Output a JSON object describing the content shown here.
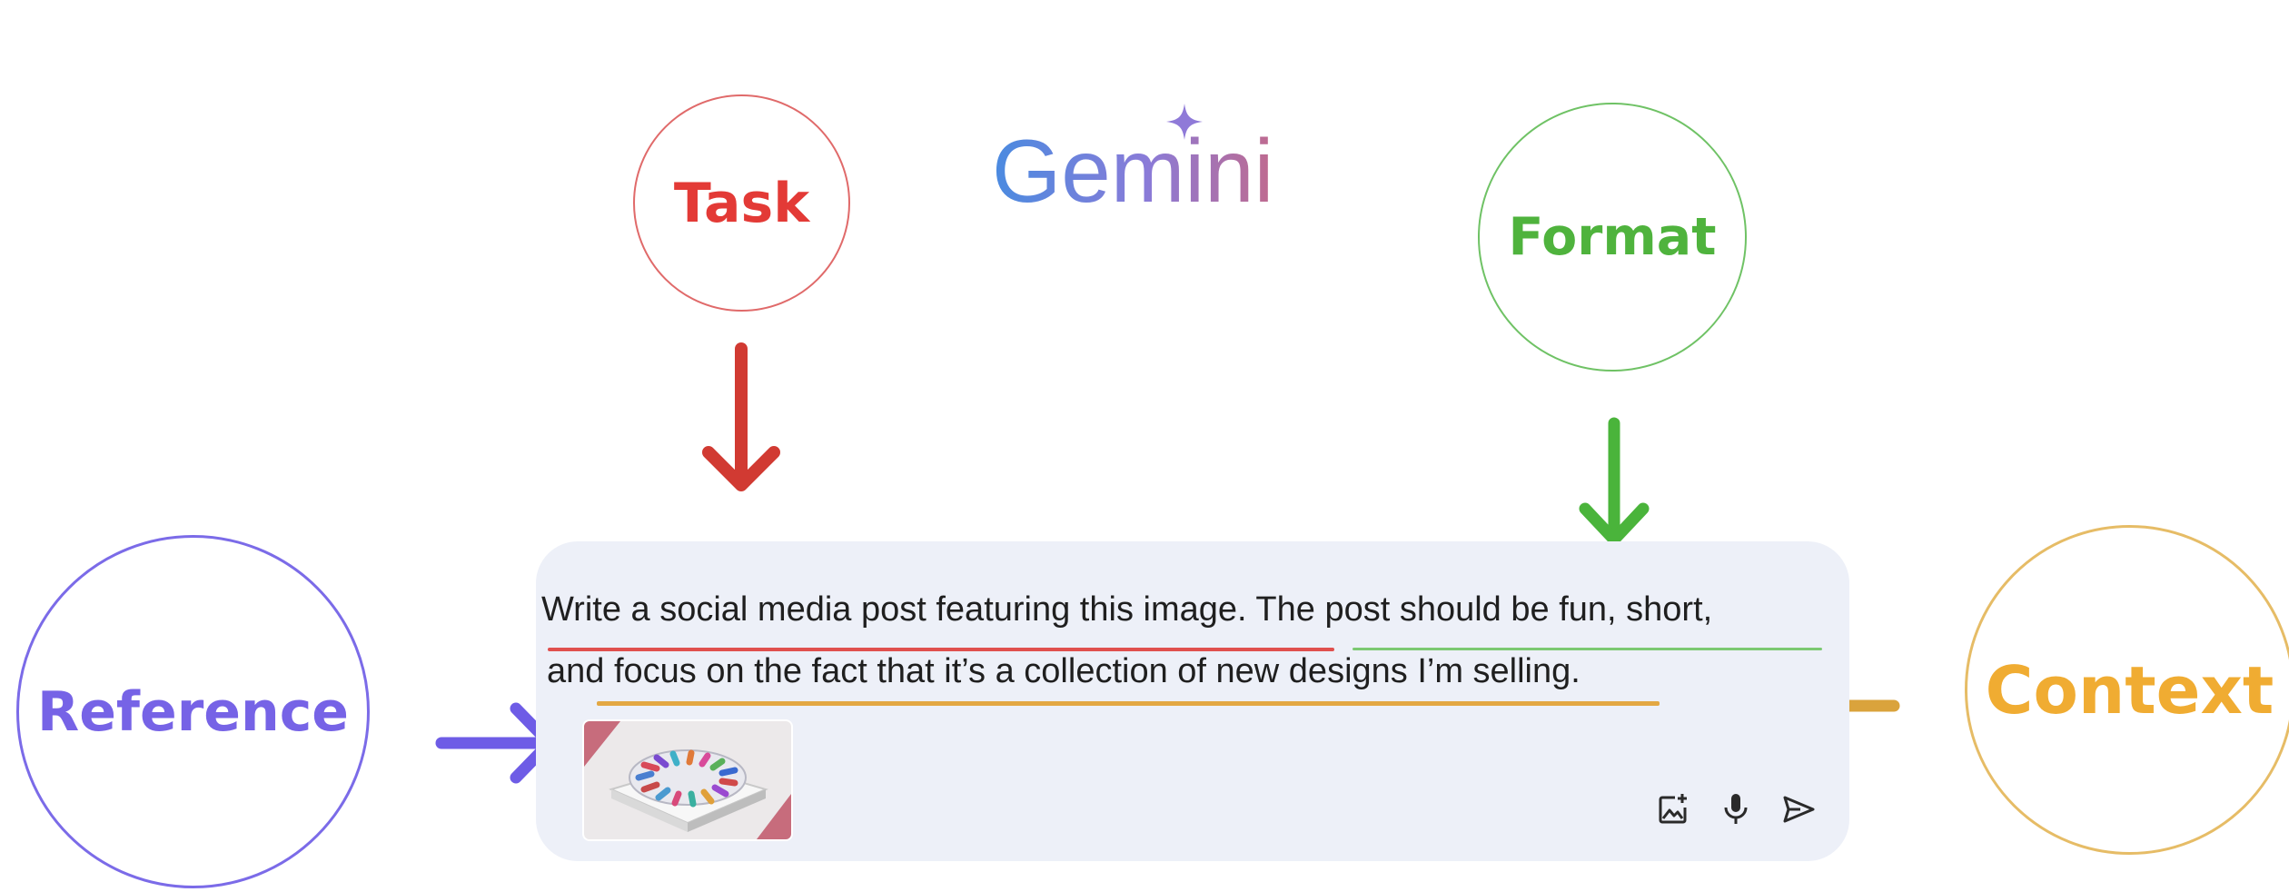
{
  "logo": {
    "text": "Gemini"
  },
  "labels": {
    "task": "Task",
    "format": "Format",
    "reference": "Reference",
    "context": "Context"
  },
  "colors": {
    "task": "#e33a36",
    "format": "#4fb33d",
    "reference": "#7663e6",
    "context": "#f0ac32",
    "prompt_box": "#edf0f8"
  },
  "prompt": {
    "line1": "Write a social media post featuring this image. The post should be fun, short,",
    "line2": "and focus on the fact that it’s a collection of new designs I’m selling."
  },
  "toolbar": {
    "icons": [
      "add-image-icon",
      "microphone-icon",
      "send-icon"
    ]
  }
}
